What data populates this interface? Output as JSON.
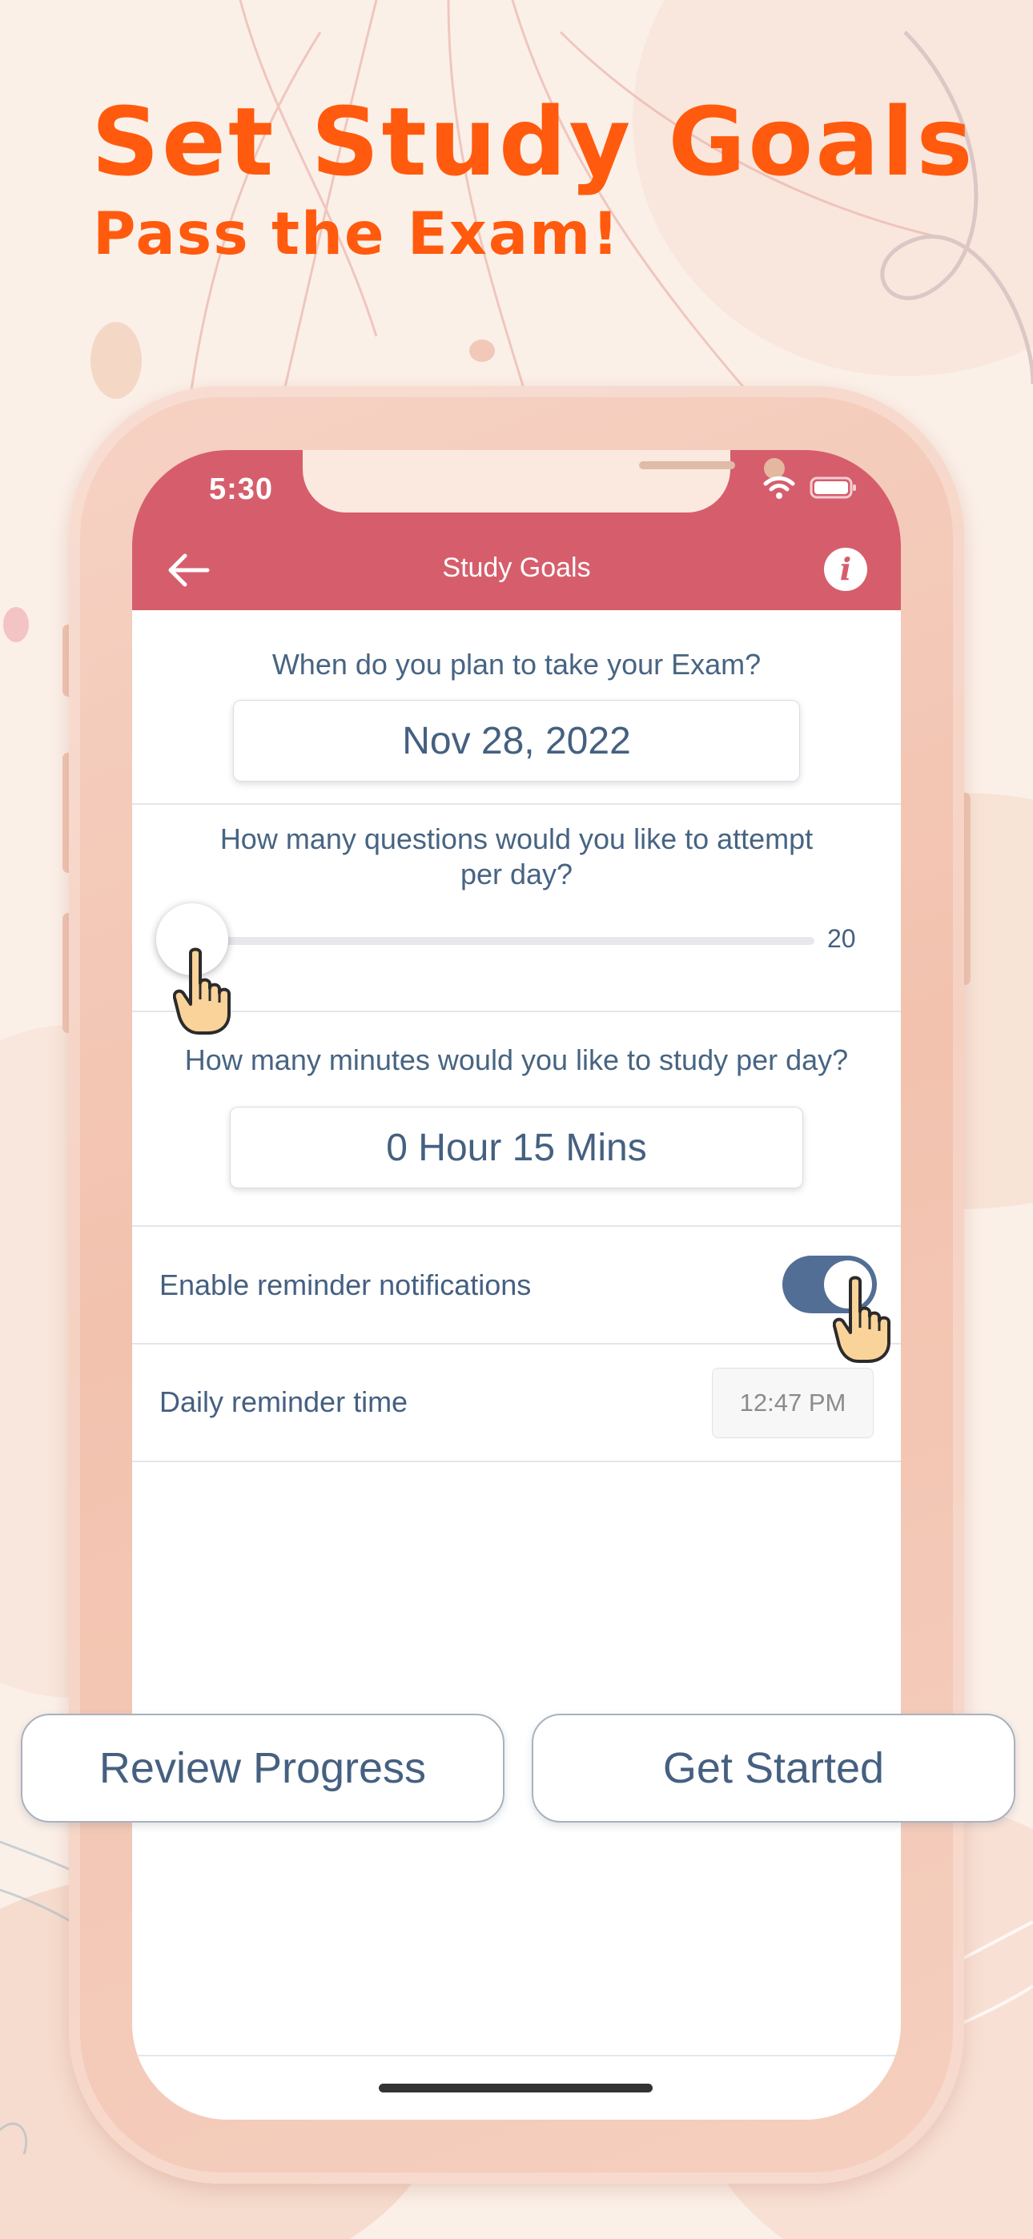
{
  "promo": {
    "headline": "Set Study Goals",
    "subheadline": "Pass the Exam!"
  },
  "status_bar": {
    "time": "5:30"
  },
  "nav": {
    "title": "Study Goals",
    "back_icon": "arrow-left-icon",
    "info_icon": "info-icon",
    "info_glyph": "i"
  },
  "exam": {
    "label": "When do you plan to take your Exam?",
    "date": "Nov 28, 2022"
  },
  "questions": {
    "label": "How many questions would you like to attempt per day?",
    "value": "20"
  },
  "minutes": {
    "label": "How many minutes would you like to study per day?",
    "value": "0 Hour 15 Mins"
  },
  "reminder": {
    "label": "Enable reminder notifications",
    "enabled": true
  },
  "reminder_time": {
    "label": "Daily reminder time",
    "value": "12:47 PM"
  },
  "actions": {
    "review": "Review Progress",
    "start": "Get Started"
  },
  "colors": {
    "accent_orange": "#ff5a0d",
    "nav_red": "#d65e6c",
    "text_blue": "#456080",
    "toggle_on": "#526e95"
  }
}
